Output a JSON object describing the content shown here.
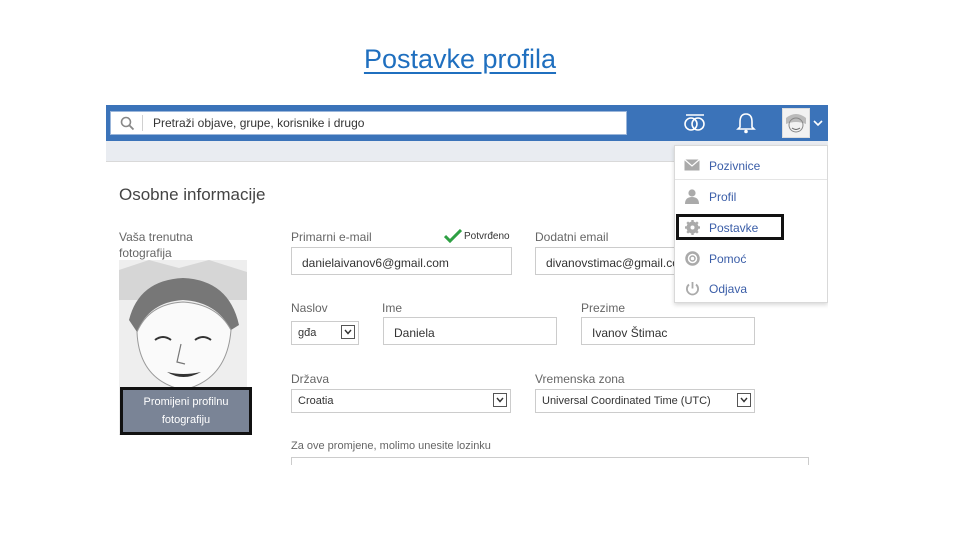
{
  "slide": {
    "title": "Postavke profila"
  },
  "topbar": {
    "search_placeholder": "Pretraži objave, grupe, korisnike i drugo",
    "icons": [
      "search-icon",
      "hands-icon",
      "bell-icon",
      "avatar",
      "chevron-down-icon"
    ],
    "accent": "#3b73b9"
  },
  "form": {
    "heading": "Osobne informacije",
    "photo_label": "Vaša trenutna fotografija",
    "change_photo_button": "Promijeni profilnu fotografiju",
    "primary_email_label": "Primarni e-mail",
    "verified_label": "Potvrđeno",
    "primary_email_value": "danielaivanov6@gmail.com",
    "secondary_email_label": "Dodatni email",
    "secondary_email_value": "divanovstimac@gmail.co",
    "title_label": "Naslov",
    "title_value": "gđa",
    "first_name_label": "Ime",
    "first_name_value": "Daniela",
    "last_name_label": "Prezime",
    "last_name_value": "Ivanov Štimac",
    "country_label": "Država",
    "country_value": "Croatia",
    "timezone_label": "Vremenska zona",
    "timezone_value": "Universal Coordinated Time (UTC)",
    "password_note": "Za ove promjene, molimo unesite lozinku"
  },
  "menu": {
    "items": [
      {
        "label": "Pozivnice",
        "icon": "envelope-icon"
      },
      {
        "label": "Profil",
        "icon": "user-icon"
      },
      {
        "label": "Postavke",
        "icon": "gear-icon"
      },
      {
        "label": "Pomoć",
        "icon": "lifebuoy-icon"
      },
      {
        "label": "Odjava",
        "icon": "power-icon"
      }
    ]
  }
}
